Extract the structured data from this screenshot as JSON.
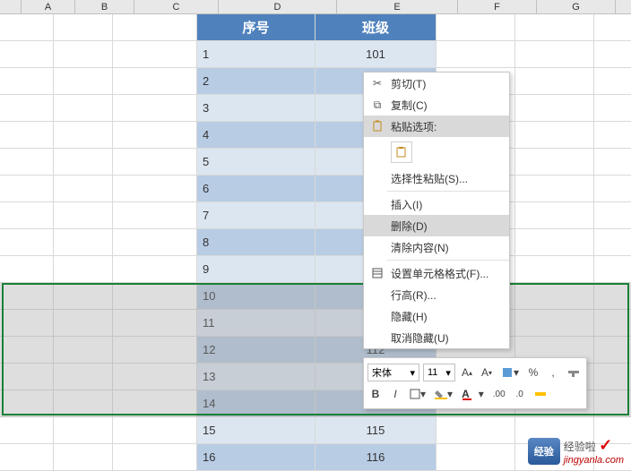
{
  "columns": [
    "A",
    "B",
    "C",
    "D",
    "E",
    "F",
    "G"
  ],
  "table": {
    "headers": {
      "seq": "序号",
      "class": "班级"
    },
    "rows": [
      {
        "seq": "1",
        "class": "101"
      },
      {
        "seq": "2",
        "class": ""
      },
      {
        "seq": "3",
        "class": ""
      },
      {
        "seq": "4",
        "class": ""
      },
      {
        "seq": "5",
        "class": ""
      },
      {
        "seq": "6",
        "class": ""
      },
      {
        "seq": "7",
        "class": ""
      },
      {
        "seq": "8",
        "class": ""
      },
      {
        "seq": "9",
        "class": ""
      },
      {
        "seq": "10",
        "class": ""
      },
      {
        "seq": "11",
        "class": ""
      },
      {
        "seq": "12",
        "class": "112"
      },
      {
        "seq": "13",
        "class": ""
      },
      {
        "seq": "14",
        "class": ""
      },
      {
        "seq": "15",
        "class": "115"
      },
      {
        "seq": "16",
        "class": "116"
      }
    ]
  },
  "selection": {
    "startRow": 10,
    "endRow": 14
  },
  "contextMenu": {
    "cut": "剪切(T)",
    "copy": "复制(C)",
    "pasteOptions": "粘贴选项:",
    "pasteSpecial": "选择性粘贴(S)...",
    "insert": "插入(I)",
    "delete": "删除(D)",
    "clear": "清除内容(N)",
    "formatCells": "设置单元格格式(F)...",
    "rowHeight": "行高(R)...",
    "hide": "隐藏(H)",
    "unhide": "取消隐藏(U)"
  },
  "miniToolbar": {
    "fontName": "宋体",
    "fontSize": "11",
    "increaseFont": "A",
    "decreaseFont": "A",
    "percent": "%",
    "comma": ",",
    "bold": "B",
    "italic": "I"
  },
  "watermark": {
    "logoText": "经验",
    "text": "经验啦",
    "url": "jingyanla.com"
  }
}
